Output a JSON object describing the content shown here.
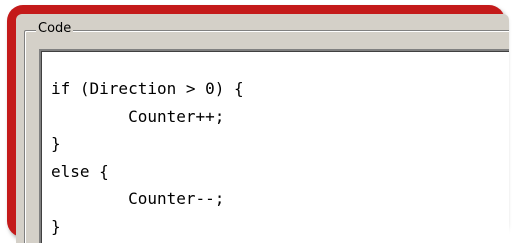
{
  "group": {
    "title": "Code"
  },
  "code": {
    "lines": [
      "if (Direction > 0) {",
      "        Counter++;",
      "}",
      "else {",
      "        Counter--;",
      "}"
    ]
  },
  "colors": {
    "frame": "#c41a1a",
    "panel": "#d4d0c8",
    "editor_background": "#ffffff"
  }
}
